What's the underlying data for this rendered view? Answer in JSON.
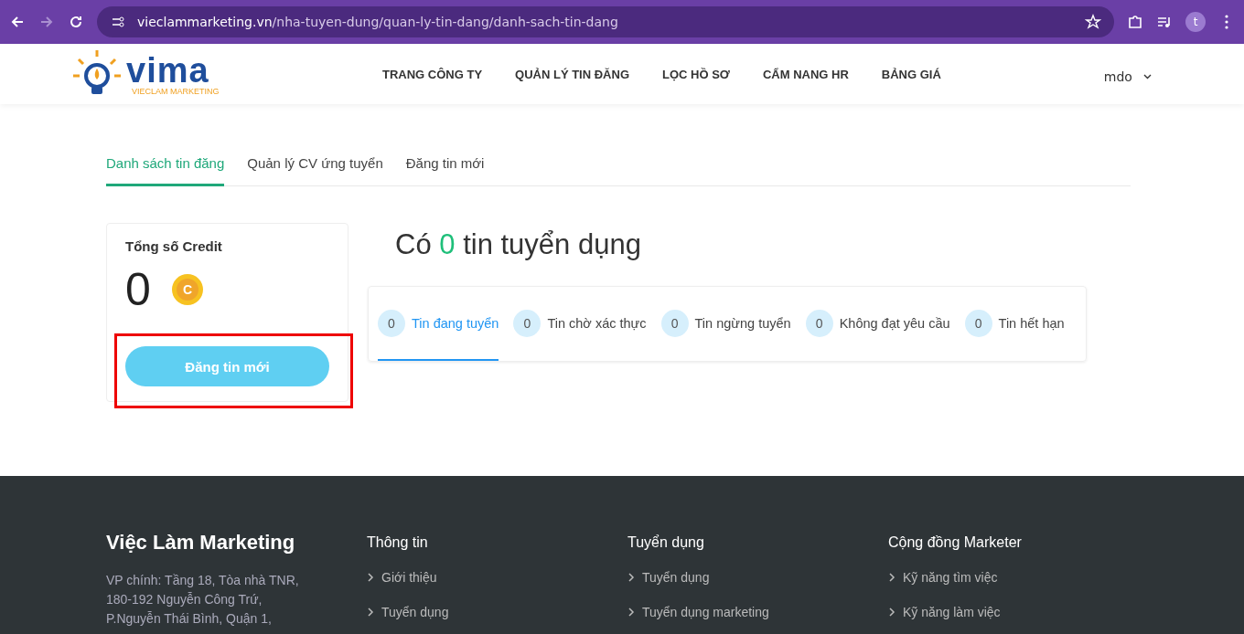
{
  "browser": {
    "url_domain": "vieclammarketing.vn",
    "url_path": "/nha-tuyen-dung/quan-ly-tin-dang/danh-sach-tin-dang",
    "profile": "t"
  },
  "header": {
    "logo_text": "vima",
    "logo_sub": "VIECLAM MARKETING",
    "nav": [
      "TRANG CÔNG TY",
      "QUẢN LÝ TIN ĐĂNG",
      "LỌC HỒ SƠ",
      "CẨM NANG HR",
      "BẢNG GIÁ"
    ],
    "user": "mdo"
  },
  "tabs": [
    {
      "label": "Danh sách tin đăng",
      "selected": true
    },
    {
      "label": "Quản lý CV ứng tuyển",
      "selected": false
    },
    {
      "label": "Đăng tin mới",
      "selected": false
    }
  ],
  "credit": {
    "title": "Tổng số Credit",
    "amount": "0",
    "coin": "C",
    "button": "Đăng tin mới",
    "annotated": true
  },
  "summary": {
    "prefix": "Có",
    "count": "0",
    "suffix": "tin tuyển dụng"
  },
  "status_tabs": [
    {
      "count": "0",
      "label": "Tin đang tuyển",
      "selected": true
    },
    {
      "count": "0",
      "label": "Tin chờ xác thực",
      "selected": false
    },
    {
      "count": "0",
      "label": "Tin ngừng tuyển",
      "selected": false
    },
    {
      "count": "0",
      "label": "Không đạt yêu cầu",
      "selected": false
    },
    {
      "count": "0",
      "label": "Tin hết hạn",
      "selected": false
    }
  ],
  "footer": {
    "brand": "Việc Làm Marketing",
    "address": [
      "VP chính: Tầng 18, Tòa nhà TNR,",
      "180-192 Nguyễn Công Trứ,",
      "P.Nguyễn Thái Bình, Quận 1,"
    ],
    "columns": [
      {
        "title": "Thông tin",
        "links": [
          "Giới thiệu",
          "Tuyển dụng"
        ]
      },
      {
        "title": "Tuyển dụng",
        "links": [
          "Tuyển dụng",
          "Tuyển dụng marketing"
        ]
      },
      {
        "title": "Cộng đồng Marketer",
        "links": [
          "Kỹ năng tìm việc",
          "Kỹ năng làm việc"
        ]
      }
    ]
  }
}
